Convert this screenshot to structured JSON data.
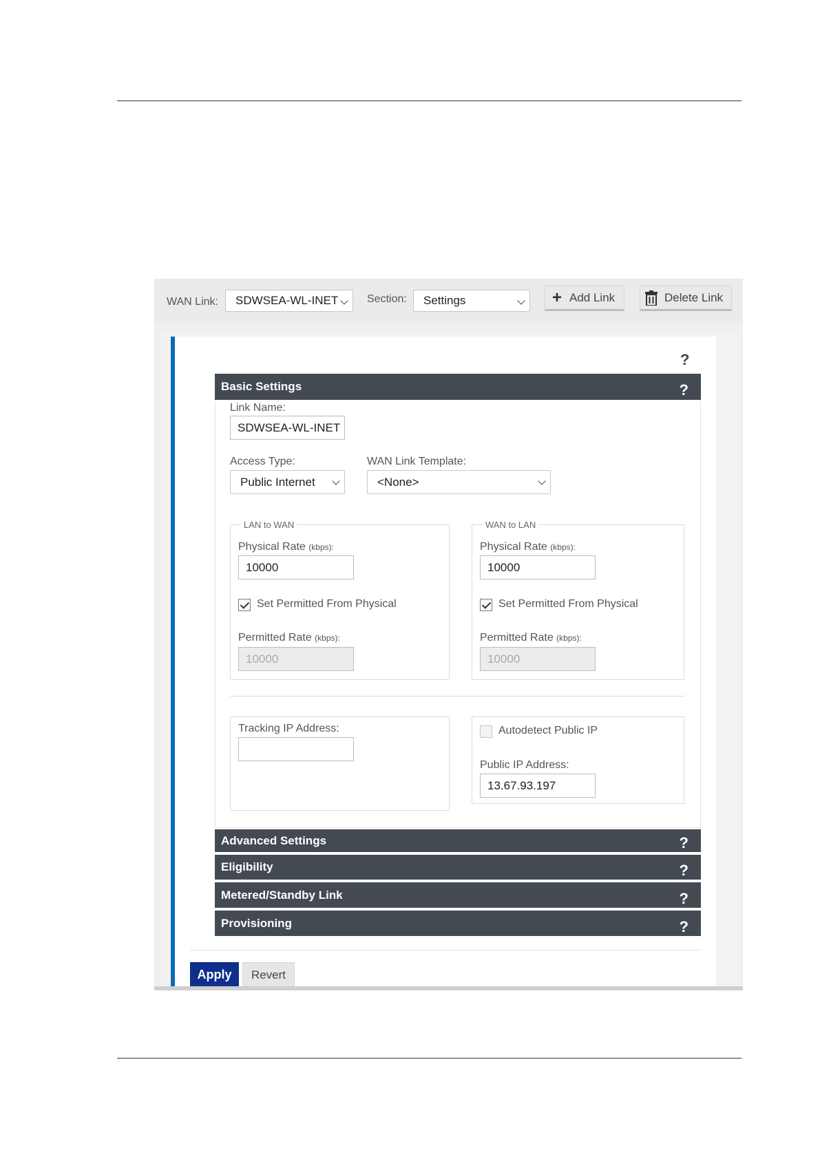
{
  "toolbar": {
    "wan_link_label": "WAN Link:",
    "wan_link_value": "SDWSEA-WL-INET",
    "section_label": "Section:",
    "section_value": "Settings",
    "add_link": "Add Link",
    "delete_link": "Delete Link"
  },
  "help_glyph": "?",
  "basic": {
    "title": "Basic Settings",
    "link_name_label": "Link Name:",
    "link_name_value": "SDWSEA-WL-INET",
    "access_type_label": "Access Type:",
    "access_type_value": "Public Internet",
    "template_label": "WAN Link Template:",
    "template_value": "<None>",
    "lan_to_wan": {
      "legend": "LAN to WAN",
      "physical_label": "Physical Rate",
      "unit": "(kbps):",
      "physical_value": "10000",
      "set_permitted_label": "Set Permitted From Physical",
      "set_permitted_checked": true,
      "permitted_label": "Permitted Rate",
      "permitted_value": "10000"
    },
    "wan_to_lan": {
      "legend": "WAN to LAN",
      "physical_label": "Physical Rate",
      "unit": "(kbps):",
      "physical_value": "10000",
      "set_permitted_label": "Set Permitted From Physical",
      "set_permitted_checked": true,
      "permitted_label": "Permitted Rate",
      "permitted_value": "10000"
    },
    "tracking_ip_label": "Tracking IP Address:",
    "tracking_ip_value": "",
    "autodetect_label": "Autodetect Public IP",
    "autodetect_checked": false,
    "public_ip_label": "Public IP Address:",
    "public_ip_value": "13.67.93.197"
  },
  "sections": {
    "advanced": "Advanced Settings",
    "eligibility": "Eligibility",
    "metered": "Metered/Standby Link",
    "provisioning": "Provisioning"
  },
  "actions": {
    "apply": "Apply",
    "revert": "Revert"
  },
  "colors": {
    "accent_blue": "#0b6cb8",
    "section_bar": "#434a52",
    "apply_button": "#0f2f8c"
  }
}
